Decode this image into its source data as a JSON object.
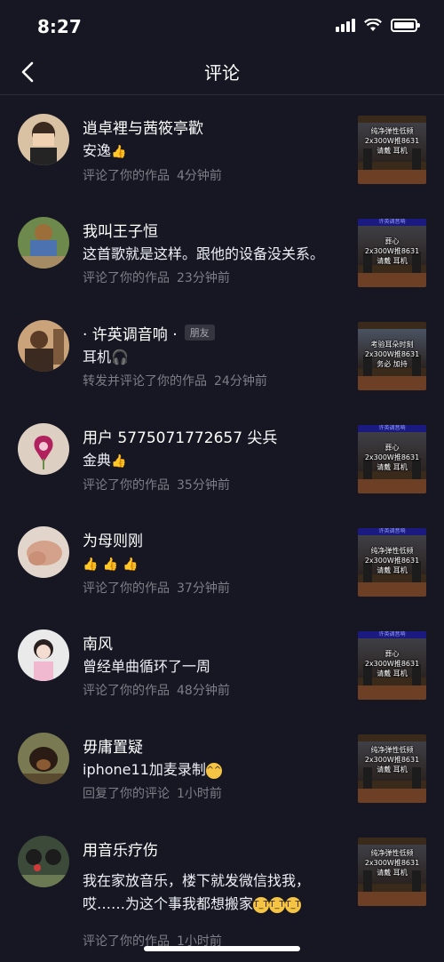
{
  "status_bar": {
    "time": "8:27"
  },
  "header": {
    "title": "评论"
  },
  "comments": [
    {
      "name": "逍卓裡与茜筱亭歡",
      "badge": "",
      "text": "安逸",
      "emojis": [
        "👍"
      ],
      "action": "评论了你的作品",
      "time": "4分钟前",
      "thumb": {
        "banner": "",
        "caption": "纯净弹性低频\n2x300W推8631\n请戴  耳机"
      }
    },
    {
      "name": "我叫王子恒",
      "badge": "",
      "text": "这首歌就是这样。跟他的设备没关系。",
      "emojis": [],
      "action": "评论了你的作品",
      "time": "23分钟前",
      "thumb": {
        "banner": "许英调音响",
        "caption": "葬心\n2x300W推8631\n请戴  耳机"
      }
    },
    {
      "name": "· 许英调音响 ·",
      "badge": "朋友",
      "text": "耳机",
      "emojis": [
        "🎧"
      ],
      "action": "转发并评论了你的作品",
      "time": "24分钟前",
      "thumb": {
        "banner": "",
        "caption": "考验耳朵时刻\n2x300W推8631\n务必  加持"
      }
    },
    {
      "name": "用户 5775071772657 尖兵",
      "badge": "",
      "text": "金典",
      "emojis": [
        "👍"
      ],
      "action": "评论了你的作品",
      "time": "35分钟前",
      "thumb": {
        "banner": "许英调音响",
        "caption": "葬心\n2x300W推8631\n请戴  耳机"
      }
    },
    {
      "name": "为母则刚",
      "badge": "",
      "text": "",
      "emojis": [
        "👍",
        "👍",
        "👍"
      ],
      "action": "评论了你的作品",
      "time": "37分钟前",
      "thumb": {
        "banner": "许英调音响",
        "caption": "纯净弹性低频\n2x300W推8631\n请戴  耳机"
      }
    },
    {
      "name": "南风",
      "badge": "",
      "text": "曾经单曲循环了一周",
      "emojis": [],
      "action": "评论了你的作品",
      "time": "48分钟前",
      "thumb": {
        "banner": "许英调音响",
        "caption": "葬心\n2x300W推8631\n请戴  耳机"
      }
    },
    {
      "name": "毋庸置疑",
      "badge": "",
      "text": "iphone11加麦录制",
      "emojis": [
        "😅"
      ],
      "action": "回复了你的评论",
      "time": "1小时前",
      "thumb": {
        "banner": "",
        "caption": "纯净弹性低频\n2x300W推8631\n请戴  耳机"
      }
    },
    {
      "name": "用音乐疗伤",
      "badge": "",
      "text": "我在家放音乐，楼下就发微信找我，哎……为这个事我都想搬家",
      "emojis": [
        "😭",
        "😭",
        "😭"
      ],
      "action": "评论了你的作品",
      "time": "1小时前",
      "thumb": {
        "banner": "",
        "caption": "纯净弹性低频\n2x300W推8631\n请戴  耳机"
      }
    }
  ]
}
